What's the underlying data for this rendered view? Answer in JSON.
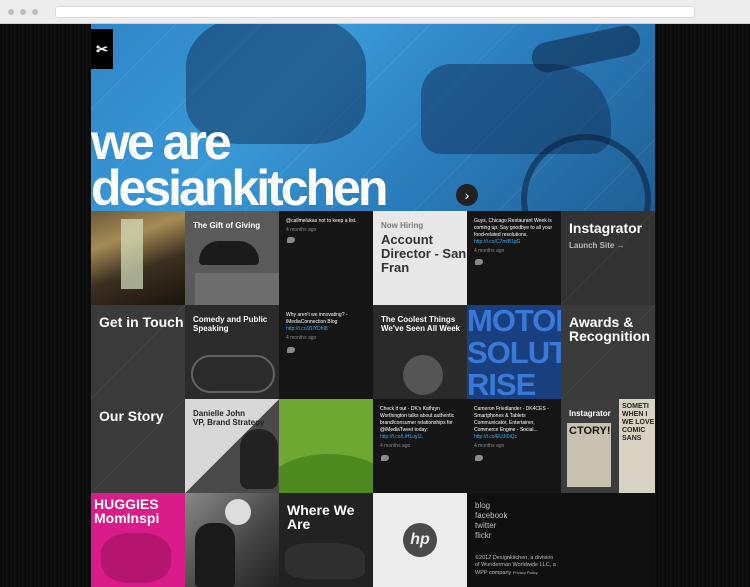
{
  "hero": {
    "title_line1": "we are",
    "title_line2": "desiankitchen",
    "logo": "✂"
  },
  "tiles": {
    "gift": "The Gift of Giving",
    "tweet1": {
      "text": "@callmelukas not to keep a list.",
      "ago": "4 months ago"
    },
    "hiring_kicker": "Now Hiring",
    "hiring_job": "Account Director - San Fran",
    "tweet2": {
      "text": "Guys, Chicago Restaurant Week is coming up. Say goodbye to all your food-related resolutions.",
      "link": "http://t.co/C7mlB1gG",
      "ago": "4 months ago"
    },
    "instagrator": "Instagrator",
    "launch": "Launch Site →",
    "get_in_touch": "Get in Touch",
    "comedy": "Comedy and Public Speaking",
    "tweet3": {
      "text": "Why aren't we innovating? - iMediaConnection Blog",
      "link": "http://t.co/ZIIYDhI8",
      "ago": "4 months ago"
    },
    "coolest": "The Coolest Things We've Seen All Week",
    "moto": "MOTOI SOLUT RISE",
    "awards": "Awards & Recognition",
    "our_story": "Our Story",
    "person_name": "Danielle John",
    "person_title": "VP, Brand Strategy",
    "tweet4": {
      "text": "Check it out - DK's Kathryn Worthington talks about authentic brand/consumer relationships for @iMediaTweet today:",
      "link": "http://t.co/LiHLuy1L",
      "ago": "4 months ago"
    },
    "tweet5": {
      "text": "Cameron Friedlander - DK4CES - Smartphones & Tablets Communicator, Entertainer, Commerce Engine - Social...",
      "link": "http://t.co/EUJt0iQc",
      "ago": "4 months ago"
    },
    "instagrator2": "Instagrator",
    "poster1": "CTORY!",
    "poster2": "SOMETI WHEN I WE LOVE COMIC SANS",
    "huggies": "HUGGIES MomInspi",
    "where": "Where We Are",
    "hp_logo": "hp",
    "social": [
      "blog",
      "facebook",
      "twitter",
      "flickr"
    ],
    "copyright": "©2012 Designkitchen, a division of Wunderman Worldwide LLC, a WPP company",
    "privacy": "Privacy Policy"
  }
}
